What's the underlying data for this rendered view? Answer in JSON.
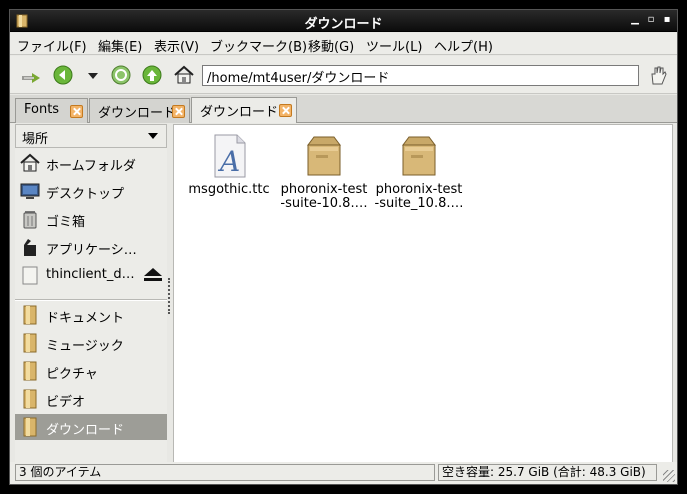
{
  "window": {
    "title": "ダウンロード"
  },
  "menubar": {
    "items": [
      {
        "label": "ファイル(F)"
      },
      {
        "label": "編集(E)"
      },
      {
        "label": "表示(V)"
      },
      {
        "label": "ブックマーク(B)"
      },
      {
        "label": "移動(G)"
      },
      {
        "label": "ツール(L)"
      },
      {
        "label": "ヘルプ(H)"
      }
    ]
  },
  "toolbar": {
    "location": "/home/mt4user/ダウンロード"
  },
  "tabs": [
    {
      "label": "Fonts",
      "active": false
    },
    {
      "label": "ダウンロード",
      "active": false
    },
    {
      "label": "ダウンロード",
      "active": true
    }
  ],
  "sidebar": {
    "header": "場所",
    "places": [
      {
        "label": "ホームフォルダ",
        "icon": "home-icon"
      },
      {
        "label": "デスクトップ",
        "icon": "desktop-icon"
      },
      {
        "label": "ゴミ箱",
        "icon": "trash-icon"
      },
      {
        "label": "アプリケーシ…",
        "icon": "applications-icon"
      },
      {
        "label": "thinclient_d…",
        "icon": "drive-icon"
      }
    ],
    "bookmarks": [
      {
        "label": "ドキュメント",
        "icon": "folder-icon"
      },
      {
        "label": "ミュージック",
        "icon": "folder-icon"
      },
      {
        "label": "ピクチャ",
        "icon": "folder-icon"
      },
      {
        "label": "ビデオ",
        "icon": "folder-icon"
      },
      {
        "label": "ダウンロード",
        "icon": "folder-icon",
        "selected": true
      }
    ]
  },
  "files": [
    {
      "name": "msgothic.ttc",
      "icon": "font-file-icon"
    },
    {
      "name": "phoronix-test-suite-10.8.…",
      "icon": "package-icon"
    },
    {
      "name": "phoronix-test-suite_10.8.…",
      "icon": "package-icon"
    }
  ],
  "status": {
    "items": "3 個のアイテム",
    "free_space": "空き容量: 25.7 GiB (合計: 48.3 GiB)"
  },
  "colors": {
    "selection": "#9d9d97",
    "titlebar": "#0c0c0c",
    "tab_close": "#f3b468"
  }
}
